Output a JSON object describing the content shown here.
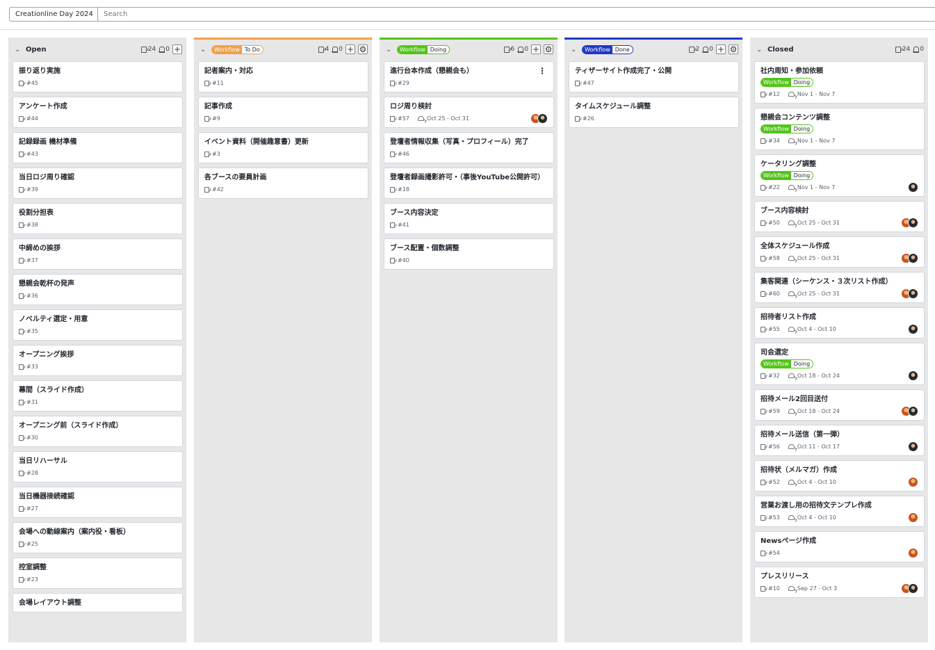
{
  "topbar": {
    "project": "Creationline Day 2024",
    "search_placeholder": "Search"
  },
  "columns": [
    {
      "id": "open",
      "title": "Open",
      "tag": null,
      "accent": "#e7e7e8",
      "count_cards": "24",
      "count_bell": "0",
      "has_add": true,
      "has_settings": false,
      "cards": [
        {
          "title": "振り返り実施",
          "num": "#45"
        },
        {
          "title": "アンケート作成",
          "num": "#44"
        },
        {
          "title": "記録録画 機材準備",
          "num": "#43"
        },
        {
          "title": "当日ロジ周り確認",
          "num": "#39"
        },
        {
          "title": "役割分担表",
          "num": "#38"
        },
        {
          "title": "中締めの挨拶",
          "num": "#37"
        },
        {
          "title": "懇親会乾杯の発声",
          "num": "#36"
        },
        {
          "title": "ノベルティ選定・用意",
          "num": "#35"
        },
        {
          "title": "オープニング挨拶",
          "num": "#33"
        },
        {
          "title": "幕間（スライド作成）",
          "num": "#31"
        },
        {
          "title": "オープニング前（スライド作成）",
          "num": "#30"
        },
        {
          "title": "当日リハーサル",
          "num": "#28"
        },
        {
          "title": "当日機器接続確認",
          "num": "#27"
        },
        {
          "title": "会場への動線案内（案内役・看板）",
          "num": "#25"
        },
        {
          "title": "控室調整",
          "num": "#23"
        },
        {
          "title": "会場レイアウト調整",
          "num": ""
        }
      ]
    },
    {
      "id": "todo",
      "title": "",
      "tag": {
        "key": "Workflow",
        "value": "To Do",
        "color": "#f0a04b"
      },
      "accent": "#f0a04b",
      "count_cards": "4",
      "count_bell": "0",
      "has_add": true,
      "has_settings": true,
      "cards": [
        {
          "title": "記者案内・対応",
          "num": "#11"
        },
        {
          "title": "記事作成",
          "num": "#9"
        },
        {
          "title": "イベント資料（開催趣意書）更新",
          "num": "#3"
        },
        {
          "title": "各ブースの要員計画",
          "num": "#42"
        }
      ]
    },
    {
      "id": "doing",
      "title": "",
      "tag": {
        "key": "Workflow",
        "value": "Doing",
        "color": "#52c41a"
      },
      "accent": "#52c41a",
      "count_cards": "6",
      "count_bell": "0",
      "has_add": true,
      "has_settings": true,
      "cards": [
        {
          "title": "進行台本作成（懇親会も）",
          "num": "#29",
          "kebab": true
        },
        {
          "title": "ロジ周り検討",
          "num": "#57",
          "date": "Oct 25 - Oct 31",
          "avatars": [
            "a",
            "b"
          ]
        },
        {
          "title": "登壇者情報収集（写真・プロフィール）完了",
          "num": "#46"
        },
        {
          "title": "登壇者録画撮影許可・（事後YouTube公開許可）",
          "num": "#18"
        },
        {
          "title": "ブース内容決定",
          "num": "#41"
        },
        {
          "title": "ブース配置・個数調整",
          "num": "#40"
        }
      ]
    },
    {
      "id": "done",
      "title": "",
      "tag": {
        "key": "Workflow",
        "value": "Done",
        "color": "#1d39c4"
      },
      "accent": "#1d39c4",
      "count_cards": "2",
      "count_bell": "0",
      "has_add": true,
      "has_settings": true,
      "cards": [
        {
          "title": "ティザーサイト作成完了・公開",
          "num": "#47"
        },
        {
          "title": "タイムスケジュール調整",
          "num": "#26"
        }
      ]
    },
    {
      "id": "closed",
      "title": "Closed",
      "tag": null,
      "accent": "#e7e7e8",
      "count_cards": "24",
      "count_bell": "0",
      "has_add": false,
      "has_settings": false,
      "cards": [
        {
          "title": "社内周知・参加依頼",
          "num": "#12",
          "date": "Nov 1 - Nov 7",
          "wf": "Doing"
        },
        {
          "title": "懇親会コンテンツ調整",
          "num": "#34",
          "date": "Nov 1 - Nov 7",
          "wf": "Doing"
        },
        {
          "title": "ケータリング調整",
          "num": "#22",
          "date": "Nov 1 - Nov 7",
          "wf": "Doing",
          "avatars": [
            "b"
          ]
        },
        {
          "title": "ブース内容検討",
          "num": "#50",
          "date": "Oct 25 - Oct 31",
          "avatars": [
            "a",
            "b"
          ]
        },
        {
          "title": "全体スケジュール作成",
          "num": "#58",
          "date": "Oct 25 - Oct 31",
          "avatars": [
            "a",
            "b"
          ]
        },
        {
          "title": "集客関連（シーケンス・３次リスト作成）",
          "num": "#60",
          "date": "Oct 25 - Oct 31",
          "avatars": [
            "a",
            "b"
          ]
        },
        {
          "title": "招待者リスト作成",
          "num": "#55",
          "date": "Oct 4 - Oct 10",
          "avatars": [
            "b"
          ]
        },
        {
          "title": "司会選定",
          "num": "#32",
          "date": "Oct 18 - Oct 24",
          "wf": "Doing",
          "avatars": [
            "b"
          ]
        },
        {
          "title": "招待メール2回目送付",
          "num": "#59",
          "date": "Oct 18 - Oct 24",
          "avatars": [
            "a",
            "b"
          ]
        },
        {
          "title": "招待メール送信（第一弾）",
          "num": "#56",
          "date": "Oct 11 - Oct 17",
          "avatars": [
            "b"
          ]
        },
        {
          "title": "招待状（メルマガ）作成",
          "num": "#52",
          "date": "Oct 4 - Oct 10",
          "avatars": [
            "a"
          ]
        },
        {
          "title": "営業お渡し用の招待文テンプレ作成",
          "num": "#53",
          "date": "Oct 4 - Oct 10",
          "avatars": [
            "a"
          ]
        },
        {
          "title": "Newsページ作成",
          "num": "#54",
          "avatars": [
            "a"
          ]
        },
        {
          "title": "プレスリリース",
          "num": "#10",
          "date": "Sep 27 - Oct 3",
          "avatars": [
            "a",
            "b"
          ]
        }
      ]
    }
  ],
  "workflow_label": "Workflow",
  "doing_color": "#52c41a"
}
